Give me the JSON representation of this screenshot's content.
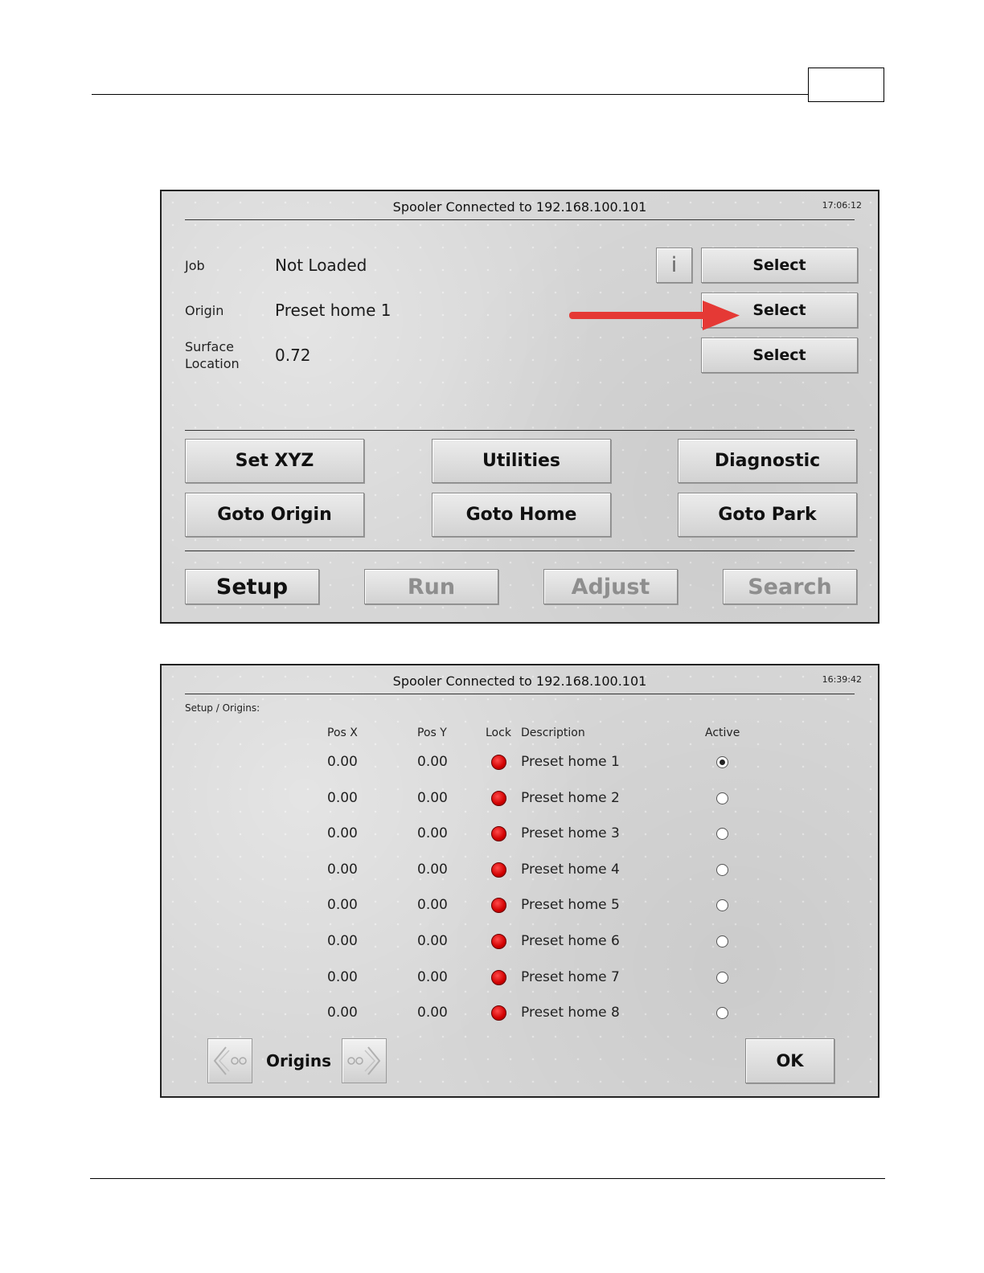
{
  "screen1": {
    "title": "Spooler Connected to 192.168.100.101",
    "clock": "17:06:12",
    "fields": [
      {
        "label": "Job",
        "value": "Not Loaded",
        "button": "Select"
      },
      {
        "label": "Origin",
        "value": "Preset home 1",
        "button": "Select"
      },
      {
        "label_line1": "Surface",
        "label_line2": "Location",
        "value": "0.72",
        "button": "Select"
      }
    ],
    "info_button": "i",
    "actions": [
      "Set XYZ",
      "Utilities",
      "Diagnostic",
      "Goto Origin",
      "Goto Home",
      "Goto Park"
    ],
    "modes": [
      "Setup",
      "Run",
      "Adjust",
      "Search"
    ],
    "arrow_color": "#e53935"
  },
  "screen2": {
    "title": "Spooler Connected to 192.168.100.101",
    "clock": "16:39:42",
    "breadcrumb": "Setup / Origins:",
    "columns": {
      "posx": "Pos X",
      "posy": "Pos Y",
      "lock": "Lock",
      "description": "Description",
      "active": "Active"
    },
    "rows": [
      {
        "posx": "0.00",
        "posy": "0.00",
        "description": "Preset home 1",
        "active": true
      },
      {
        "posx": "0.00",
        "posy": "0.00",
        "description": "Preset home 2",
        "active": false
      },
      {
        "posx": "0.00",
        "posy": "0.00",
        "description": "Preset home 3",
        "active": false
      },
      {
        "posx": "0.00",
        "posy": "0.00",
        "description": "Preset home 4",
        "active": false
      },
      {
        "posx": "0.00",
        "posy": "0.00",
        "description": "Preset home 5",
        "active": false
      },
      {
        "posx": "0.00",
        "posy": "0.00",
        "description": "Preset home 6",
        "active": false
      },
      {
        "posx": "0.00",
        "posy": "0.00",
        "description": "Preset home 7",
        "active": false
      },
      {
        "posx": "0.00",
        "posy": "0.00",
        "description": "Preset home 8",
        "active": false
      }
    ],
    "page_label": "Origins",
    "ok_button": "OK",
    "lock_color": "#e00000"
  }
}
